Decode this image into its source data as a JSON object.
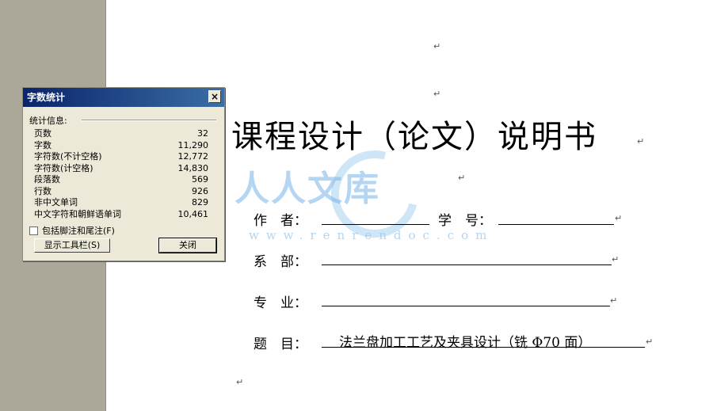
{
  "document": {
    "title": "课程设计（论文）说明书",
    "watermark": {
      "text": "人人文库",
      "url": "www.renrendoc.com"
    },
    "paragraph_mark": "↵",
    "fields": [
      {
        "label": "作　者：",
        "extra_label": "学　号：",
        "value": ""
      },
      {
        "label": "系　部：",
        "value": ""
      },
      {
        "label": "专　业：",
        "value": ""
      },
      {
        "label": "题　目：",
        "value": "法兰盘加工工艺及夹具设计（铣 Φ70 面）"
      }
    ]
  },
  "dialog": {
    "title": "字数统计",
    "close_glyph": "×",
    "group_label": "统计信息:",
    "stats": [
      {
        "label": "页数",
        "value": "32"
      },
      {
        "label": "字数",
        "value": "11,290"
      },
      {
        "label": "字符数(不计空格)",
        "value": "12,772"
      },
      {
        "label": "字符数(计空格)",
        "value": "14,830"
      },
      {
        "label": "段落数",
        "value": "569"
      },
      {
        "label": "行数",
        "value": "926"
      },
      {
        "label": "非中文单词",
        "value": "829"
      },
      {
        "label": "中文字符和朝鲜语单词",
        "value": "10,461"
      }
    ],
    "checkbox_label": "包括脚注和尾注(F)",
    "checkbox_checked": false,
    "button_toolbar": "显示工具栏(S)",
    "button_close": "关闭"
  }
}
